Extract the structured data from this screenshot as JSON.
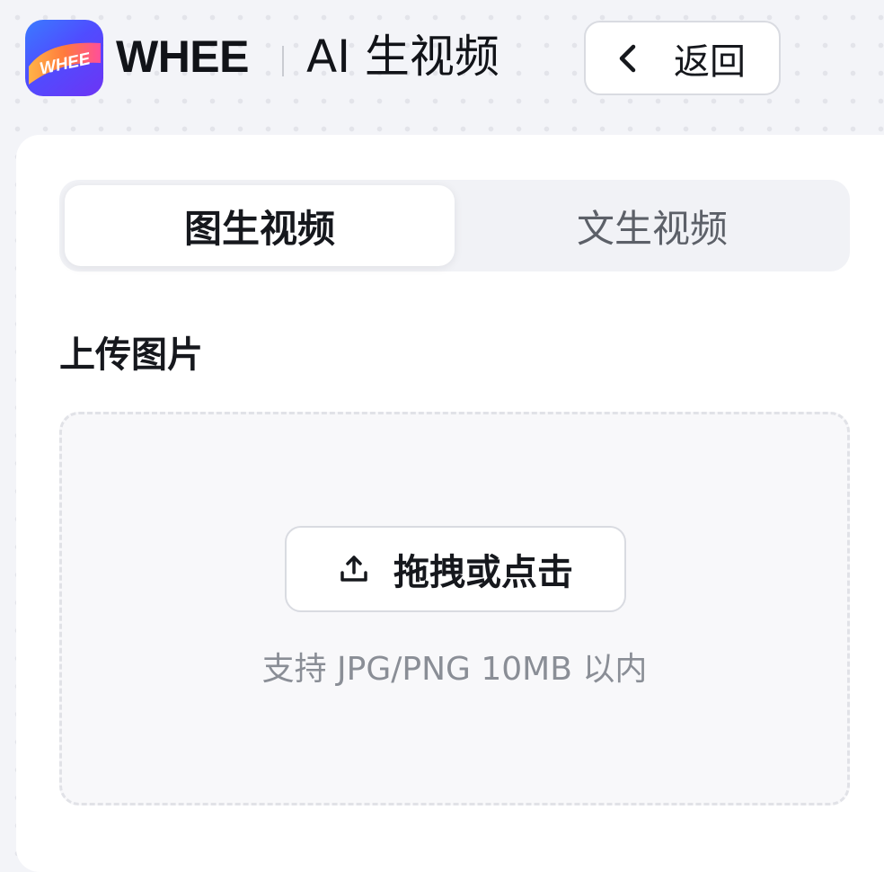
{
  "header": {
    "logo_text": "WHEE",
    "brand": "WHEE",
    "section_title": "AI 生视频",
    "back_label": "返回"
  },
  "tabs": [
    {
      "label": "图生视频",
      "active": true
    },
    {
      "label": "文生视频",
      "active": false
    }
  ],
  "upload": {
    "section_label": "上传图片",
    "button_label": "拖拽或点击",
    "hint": "支持 JPG/PNG 10MB 以内"
  },
  "icons": {
    "back": "chevron-left-icon",
    "upload": "upload-icon"
  },
  "colors": {
    "page_background": "#f3f4f8",
    "panel_background": "#ffffff",
    "logo_gradient_start": "#3a7bff",
    "logo_gradient_end": "#6d34f4",
    "logo_ribbon_orange": "#ff8a3d",
    "logo_ribbon_pink": "#ff4f9a",
    "text_primary": "#16181d",
    "text_secondary": "#8a8e96"
  }
}
